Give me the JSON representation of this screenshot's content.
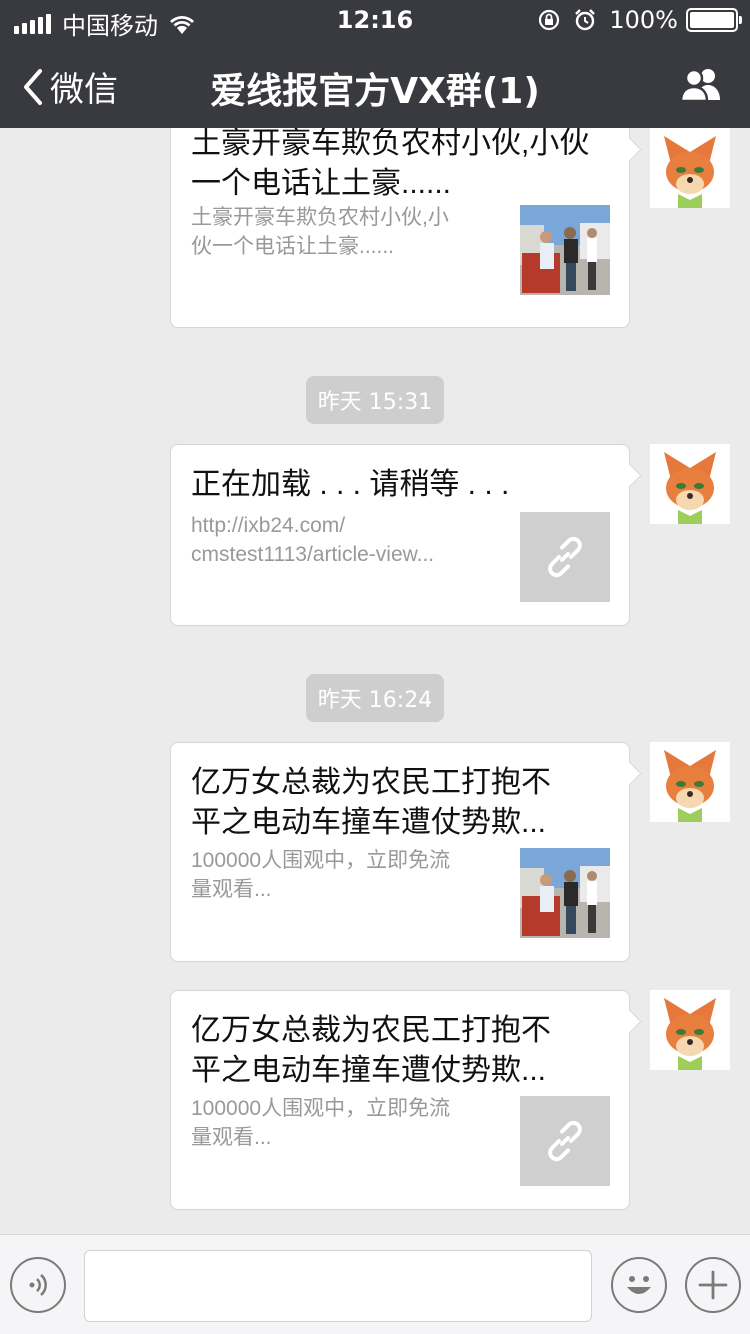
{
  "status_bar": {
    "carrier": "中国移动",
    "time": "12:16",
    "battery_percent": "100%",
    "battery_level": 1.0
  },
  "nav": {
    "back_label": "微信",
    "title": "爱线报官方VX群(1)",
    "members_icon": "group-members-icon"
  },
  "messages": [
    {
      "type": "link-card",
      "title": "土豪开豪车欺负农村小伙,小伙一个电话让土豪......",
      "desc_lines": [
        "土豪开豪车欺负农村小伙,小",
        "伙一个电话让土豪......"
      ],
      "thumb": "photo"
    },
    {
      "type": "timestamp",
      "text": "昨天 15:31"
    },
    {
      "type": "link-card",
      "title": "正在加载 . . . 请稍等 . . .",
      "desc_lines": [
        "http://ixb24.com/",
        "cmstest1113/article-view..."
      ],
      "thumb": "link-icon"
    },
    {
      "type": "timestamp",
      "text": "昨天 16:24"
    },
    {
      "type": "link-card",
      "title_lines": [
        "亿万女总裁为农民工打抱不",
        "平之电动车撞车遭仗势欺..."
      ],
      "desc_lines": [
        "100000人围观中，立即免流",
        "量观看..."
      ],
      "thumb": "photo"
    },
    {
      "type": "link-card",
      "title_lines": [
        "亿万女总裁为农民工打抱不",
        "平之电动车撞车遭仗势欺..."
      ],
      "desc_lines": [
        "100000人围观中，立即免流",
        "量观看..."
      ],
      "thumb": "link-icon"
    }
  ],
  "input_bar": {
    "voice_icon": "voice-icon",
    "emoji_icon": "emoji-icon",
    "more_icon": "plus-icon",
    "placeholder": ""
  },
  "colors": {
    "nav_bg": "#393a3f",
    "chat_bg": "#ebebeb",
    "timestamp_bg": "#cecece",
    "desc_text": "#999999"
  }
}
